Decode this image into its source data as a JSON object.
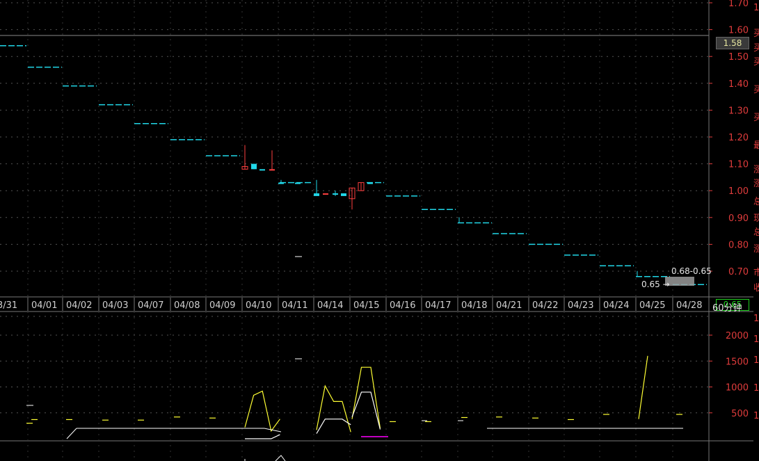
{
  "price_axis": {
    "ticks": [
      "1.70",
      "1.60",
      "1.50",
      "1.40",
      "1.30",
      "1.20",
      "1.10",
      "1.00",
      "0.90",
      "0.80",
      "0.70"
    ],
    "min": 0.635,
    "max": 1.7
  },
  "volume_axis": {
    "ticks": [
      "2000",
      "1500",
      "1000",
      "500"
    ],
    "max": 2000
  },
  "current_price_label": "1.58",
  "last_price_label": "0.65",
  "period_label": "60分钟",
  "range_label": "0.68-0.65",
  "cursor_label": "0.65",
  "cursor_arrow": "→",
  "date_labels": [
    "3/31",
    "04/01",
    "04/02",
    "04/03",
    "04/07",
    "04/08",
    "04/09",
    "04/10",
    "04/11",
    "04/14",
    "04/15",
    "04/16",
    "04/17",
    "04/18",
    "04/21",
    "04/22",
    "04/23",
    "04/24",
    "04/25",
    "04/28"
  ],
  "edge_glyphs": [
    "1",
    "买",
    "买",
    "买",
    "买",
    "买",
    "最",
    "涨",
    "涨",
    "总",
    "现",
    "总",
    "涨",
    "市",
    "收",
    "1",
    "1",
    "1",
    "1",
    "1"
  ],
  "colors": {
    "background": "#000000",
    "up": "#ff4040",
    "down": "#21d7e8",
    "grid": "#555555",
    "axis_text": "#e03c3c",
    "volume_yellow": "#ffff33",
    "volume_white": "#ffffff",
    "volume_magenta": "#ff00ff",
    "last_price_green": "#1fd11f"
  },
  "chart_data": {
    "type": "candlestick",
    "title": "",
    "xlabel": "",
    "ylabel": "",
    "ylim": [
      0.635,
      1.7
    ],
    "categories": [
      "3/31",
      "04/01",
      "04/02",
      "04/03",
      "04/07",
      "04/08",
      "04/09",
      "04/10",
      "04/11",
      "04/14",
      "04/15",
      "04/16",
      "04/17",
      "04/18",
      "04/21",
      "04/22",
      "04/23",
      "04/24",
      "04/25",
      "04/28"
    ],
    "daily_limit_levels": [
      1.54,
      1.46,
      1.39,
      1.32,
      1.25,
      1.19,
      1.13,
      null,
      1.03,
      null,
      1.03,
      0.98,
      0.93,
      0.88,
      0.84,
      0.8,
      0.76,
      0.72,
      0.68,
      0.65
    ],
    "candles": [
      {
        "day": "04/10",
        "open": 1.09,
        "close": 1.08,
        "high": 1.17,
        "low": 1.08,
        "color": "up"
      },
      {
        "day": "04/10",
        "open": 1.1,
        "close": 1.08,
        "high": 1.1,
        "low": 1.08,
        "color": "down"
      },
      {
        "day": "04/10",
        "open": 1.08,
        "close": 1.08,
        "high": 1.08,
        "low": 1.08,
        "color": "down"
      },
      {
        "day": "04/10",
        "open": 1.08,
        "close": 1.08,
        "high": 1.15,
        "low": 1.08,
        "color": "up"
      },
      {
        "day": "04/11",
        "open": 1.03,
        "close": 1.03,
        "high": 1.04,
        "low": 1.03,
        "color": "down"
      },
      {
        "day": "04/11",
        "open": 1.03,
        "close": 1.03,
        "high": 1.03,
        "low": 1.03,
        "color": "down"
      },
      {
        "day": "04/14",
        "open": 0.99,
        "close": 0.98,
        "high": 1.04,
        "low": 0.98,
        "color": "down"
      },
      {
        "day": "04/14",
        "open": 0.99,
        "close": 0.99,
        "high": 0.99,
        "low": 0.99,
        "color": "up"
      },
      {
        "day": "04/14",
        "open": 0.99,
        "close": 0.99,
        "high": 1.0,
        "low": 0.98,
        "color": "down"
      },
      {
        "day": "04/14",
        "open": 0.99,
        "close": 0.98,
        "high": 0.99,
        "low": 0.98,
        "color": "down"
      },
      {
        "day": "04/15",
        "open": 0.97,
        "close": 1.01,
        "high": 1.01,
        "low": 0.93,
        "color": "up"
      },
      {
        "day": "04/15",
        "open": 1.0,
        "close": 1.03,
        "high": 1.03,
        "low": 1.0,
        "color": "up"
      },
      {
        "day": "04/15",
        "open": 1.03,
        "close": 1.03,
        "high": 1.03,
        "low": 1.03,
        "color": "down"
      }
    ],
    "volume": {
      "ylim": [
        0,
        2000
      ],
      "series": [
        {
          "segment": "04/10",
          "color": "yellow",
          "points": [
            [
              0,
              220
            ],
            [
              1,
              840
            ],
            [
              2,
              920
            ],
            [
              3,
              150
            ],
            [
              4,
              380
            ]
          ]
        },
        {
          "segment": "04/14",
          "color": "yellow",
          "points": [
            [
              0,
              170
            ],
            [
              1,
              1020
            ],
            [
              2,
              720
            ],
            [
              3,
              720
            ],
            [
              4,
              130
            ]
          ]
        },
        {
          "segment": "04/15",
          "color": "yellow",
          "points": [
            [
              0,
              380
            ],
            [
              1,
              1380
            ],
            [
              2,
              1380
            ],
            [
              3,
              200
            ]
          ]
        },
        {
          "segment": "04/25",
          "color": "yellow",
          "points": [
            [
              0,
              380
            ],
            [
              1,
              1600
            ]
          ]
        },
        {
          "segment": "04/10",
          "color": "white",
          "points": [
            [
              0,
              0
            ],
            [
              3,
              0
            ],
            [
              4,
              80
            ]
          ]
        },
        {
          "segment": "04/14",
          "color": "white",
          "points": [
            [
              0,
              100
            ],
            [
              1,
              380
            ],
            [
              2,
              380
            ],
            [
              3,
              380
            ],
            [
              4,
              270
            ]
          ]
        },
        {
          "segment": "04/15",
          "color": "white",
          "points": [
            [
              0,
              420
            ],
            [
              1,
              900
            ],
            [
              2,
              900
            ],
            [
              3,
              180
            ]
          ]
        }
      ],
      "flat_day_marks": [
        {
          "day": "3/31",
          "value": 300
        },
        {
          "day": "04/01",
          "value": 370
        },
        {
          "day": "04/02",
          "value": 370
        },
        {
          "day": "04/03",
          "value": 360
        },
        {
          "day": "04/07",
          "value": 360
        },
        {
          "day": "04/08",
          "value": 420
        },
        {
          "day": "04/09",
          "value": 400
        },
        {
          "day": "04/16",
          "value": 330
        },
        {
          "day": "04/17",
          "value": 330
        },
        {
          "day": "04/18",
          "value": 410
        },
        {
          "day": "04/21",
          "value": 420
        },
        {
          "day": "04/22",
          "value": 400
        },
        {
          "day": "04/23",
          "value": 370
        },
        {
          "day": "04/24",
          "value": 470
        },
        {
          "day": "04/28",
          "value": 470
        }
      ]
    }
  }
}
